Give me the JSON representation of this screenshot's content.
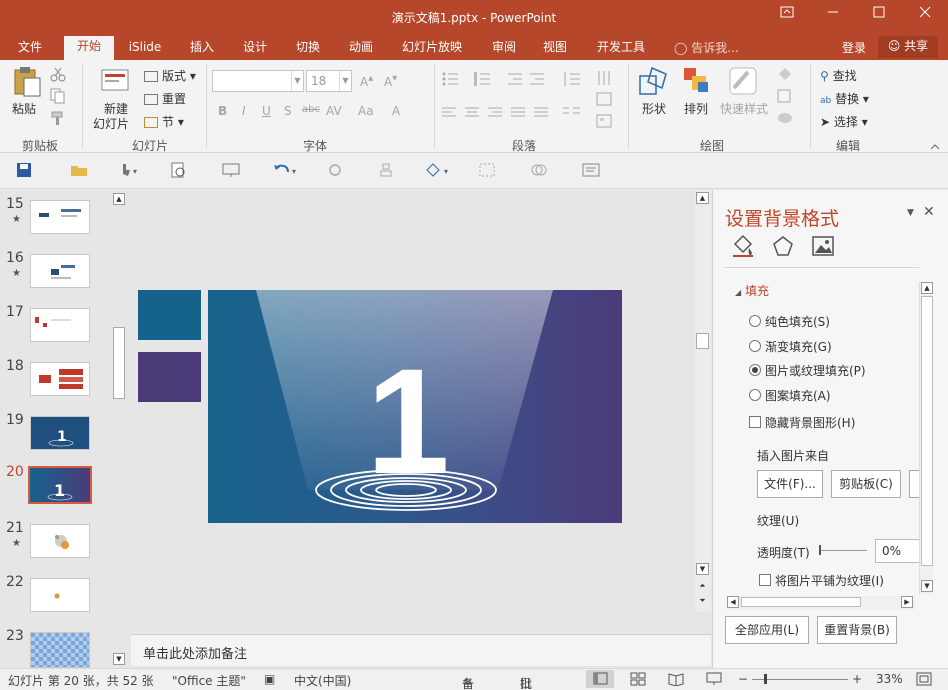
{
  "window": {
    "title": "演示文稿1.pptx - PowerPoint"
  },
  "tabs": [
    {
      "label": "文件",
      "active": false
    },
    {
      "label": "开始",
      "active": true
    },
    {
      "label": "iSlide",
      "active": false
    },
    {
      "label": "插入",
      "active": false
    },
    {
      "label": "设计",
      "active": false
    },
    {
      "label": "切换",
      "active": false
    },
    {
      "label": "动画",
      "active": false
    },
    {
      "label": "幻灯片放映",
      "active": false
    },
    {
      "label": "审阅",
      "active": false
    },
    {
      "label": "视图",
      "active": false
    },
    {
      "label": "开发工具",
      "active": false
    }
  ],
  "tellme": "告诉我...",
  "login": "登录",
  "share": "共享",
  "ribbon": {
    "clipboard": {
      "paste": "粘贴",
      "group": "剪贴板"
    },
    "slides": {
      "new_slide_line1": "新建",
      "new_slide_line2": "幻灯片",
      "layout": "版式",
      "reset": "重置",
      "section": "节",
      "group": "幻灯片"
    },
    "font": {
      "size": "18",
      "group": "字体",
      "bold": "B",
      "italic": "I",
      "underline": "U",
      "shadow": "S",
      "strike": "abc",
      "spacing": "AV",
      "case": "Aa"
    },
    "paragraph": {
      "group": "段落"
    },
    "drawing": {
      "shape": "形状",
      "arrange": "排列",
      "quick_styles": "快速样式",
      "group": "绘图"
    },
    "editing": {
      "find": "查找",
      "replace": "替换",
      "select": "选择",
      "group": "编辑"
    }
  },
  "thumbnails": [
    {
      "num": "15",
      "star": true,
      "selected": false
    },
    {
      "num": "16",
      "star": true,
      "selected": false
    },
    {
      "num": "17",
      "star": false,
      "selected": false
    },
    {
      "num": "18",
      "star": false,
      "selected": false
    },
    {
      "num": "19",
      "star": false,
      "selected": false
    },
    {
      "num": "20",
      "star": false,
      "selected": true
    },
    {
      "num": "21",
      "star": true,
      "selected": false
    },
    {
      "num": "22",
      "star": false,
      "selected": false
    },
    {
      "num": "23",
      "star": false,
      "selected": false
    }
  ],
  "slide": {
    "big_number": "1"
  },
  "notes_placeholder": "单击此处添加备注",
  "format_pane": {
    "title": "设置背景格式",
    "section": "填充",
    "options": [
      {
        "label": "纯色填充(S)",
        "type": "radio",
        "checked": false
      },
      {
        "label": "渐变填充(G)",
        "type": "radio",
        "checked": false
      },
      {
        "label": "图片或纹理填充(P)",
        "type": "radio",
        "checked": true
      },
      {
        "label": "图案填充(A)",
        "type": "radio",
        "checked": false
      },
      {
        "label": "隐藏背景图形(H)",
        "type": "checkbox",
        "checked": false
      }
    ],
    "insert_from": "插入图片来自",
    "file_btn": "文件(F)...",
    "clipboard_btn": "剪贴板(C)",
    "texture": "纹理(U)",
    "transparency_label": "透明度(T)",
    "transparency_value": "0%",
    "tile_label": "将图片平铺为纹理(I)",
    "apply_all": "全部应用(L)",
    "reset_bg": "重置背景(B)"
  },
  "status": {
    "slide_info": "幻灯片 第 20 张，共 52 张",
    "theme": "\"Office 主题\"",
    "language": "中文(中国)",
    "notes": "备注",
    "comments": "批注",
    "zoom": "33%"
  },
  "colors": {
    "accent": "#b7472a",
    "slide_left": "#16638c",
    "slide_right": "#4b3b7a",
    "swatch1": "#15638a",
    "swatch2": "#4b3a78"
  }
}
